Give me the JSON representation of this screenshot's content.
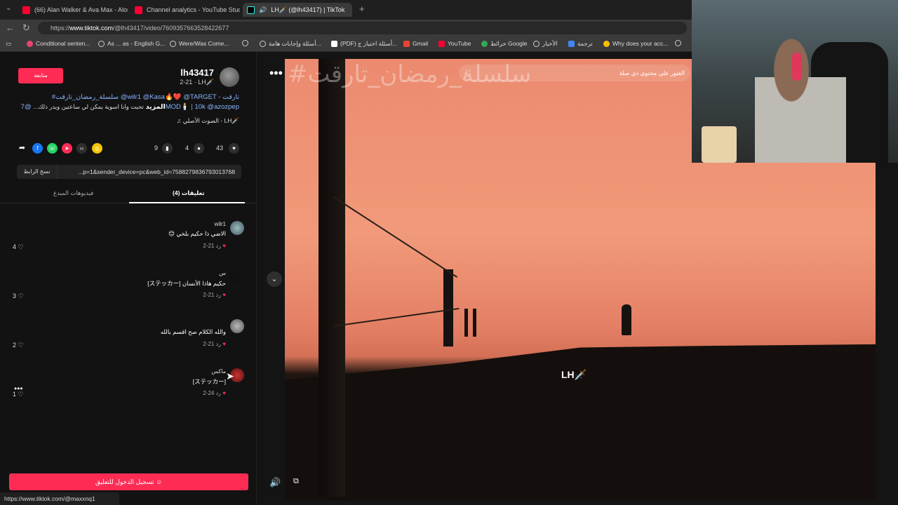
{
  "browser": {
    "tabs": [
      {
        "title": "(66) Alan Walker & Ava Max - Alone",
        "icon": "youtube-icon"
      },
      {
        "title": "Channel analytics - YouTube Studio",
        "icon": "youtube-studio-icon"
      },
      {
        "title": "LH🗡️ (@lh43417) | TikTok",
        "icon": "tiktok-icon"
      }
    ],
    "url_prefix": "https://",
    "url_host": "www.tiktok.com",
    "url_path": "/@lh43417/video/7609357663528422677",
    "bookmarks": [
      "Conditional senten...",
      "As ... as - English G...",
      "Were/Was Come...",
      "أسئلة وإجابات هامة...",
      "(PDF) أسئلة اختيار ج...",
      "Gmail",
      "YouTube",
      "خرائط Google",
      "الأخبار",
      "ترجمة",
      "Why does your acc..."
    ],
    "status_url": "https://www.tiktok.com/@maxxnq1"
  },
  "post": {
    "follow_label": "متابعة",
    "username": "lh43417",
    "date_line": "2-21 · LH🗡️",
    "desc_line1": "#سلسلة_رمضان_تارقت @wilr1 @Kasa🔥❤️ @TARGET - تارقت",
    "desc_line2_blue": "@7MOD🕯️ | 10k @azozpep",
    "desc_line2_gray": "تحبت وانا اسوية يمكن لي ساعتين ويدر ذلك...",
    "desc_more": "المزيد",
    "sound": "♫ الصوت الأصلي - LH🗡️",
    "likes": "43",
    "comments_count": "4",
    "saves": "9",
    "copy_link_label": "نسخ الرابط",
    "link_text": "...p=1&sender_device=pc&web_id=7588279836793013768"
  },
  "tabs": {
    "creator_videos": "فيديوهات المبدع",
    "comments": "تعليقات (4)"
  },
  "comments": [
    {
      "name": "wilr1",
      "text": "😊 الاضي ذا حكيم بلخي",
      "date": "2-21",
      "reply": "رد",
      "likes": "4"
    },
    {
      "name": "س",
      "text": "[ステッカー] حكيم هاذا الأنسان",
      "date": "2-21",
      "reply": "رد",
      "likes": "3"
    },
    {
      "name": "",
      "text": "والله الكلام صح اقسم بالله",
      "date": "2-21",
      "reply": "رد",
      "likes": "2"
    },
    {
      "name": "ماكس",
      "text": "[ステッカー]",
      "date": "2-24",
      "reply": "رد",
      "likes": "1"
    }
  ],
  "login_button": "تسجيل الدخول للتعليق",
  "video": {
    "overlay_title": "#سلسلة_رمضان_تارقت",
    "search_placeholder": "العثور على محتوى ذي صلة",
    "watermark": "LH🗡️"
  },
  "colors": {
    "accent": "#fe2c55"
  }
}
